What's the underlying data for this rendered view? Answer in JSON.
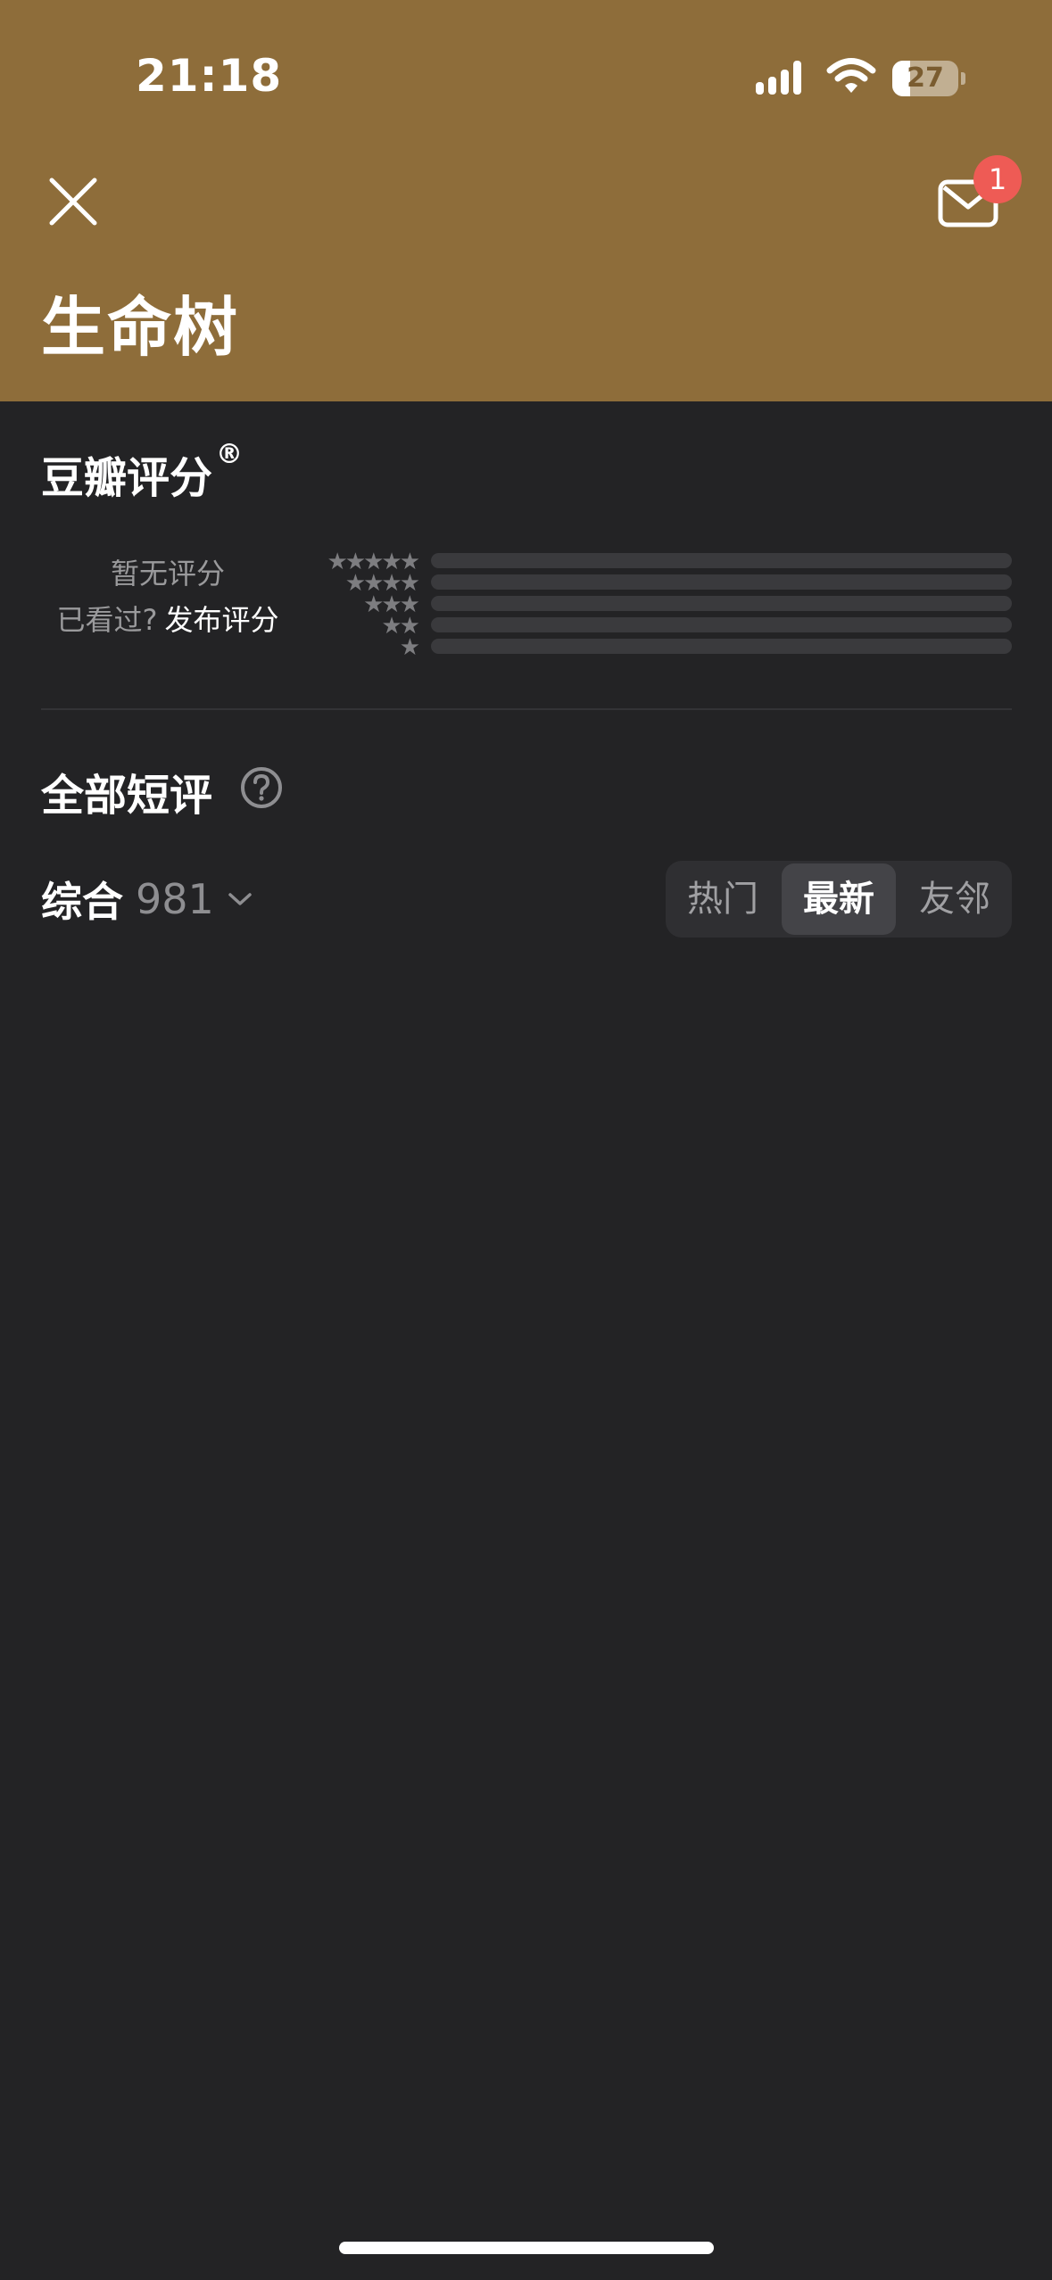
{
  "status_bar": {
    "time": "21:18",
    "battery_level": "27",
    "battery_fraction": 0.27,
    "signal_icon": "cellular-signal-icon",
    "wifi_icon": "wifi-icon"
  },
  "header": {
    "title": "生命树",
    "close_icon": "close-icon",
    "mail_icon": "envelope-icon",
    "mail_badge": "1",
    "background_color": "#8e6d3a"
  },
  "rating": {
    "title": "豆瓣评分",
    "registered_mark": "®",
    "no_rating_text": "暂无评分",
    "seen_prompt": "已看过?",
    "post_rating_link": "发布评分",
    "distribution": [
      {
        "stars": 5,
        "fraction": 0
      },
      {
        "stars": 4,
        "fraction": 0
      },
      {
        "stars": 3,
        "fraction": 0
      },
      {
        "stars": 2,
        "fraction": 0
      },
      {
        "stars": 1,
        "fraction": 0
      }
    ]
  },
  "comments": {
    "title": "全部短评",
    "help_icon": "question-circle-icon",
    "sort_label": "综合",
    "count": "981",
    "tabs": [
      {
        "label": "热门",
        "active": false
      },
      {
        "label": "最新",
        "active": true
      },
      {
        "label": "友邻",
        "active": false
      }
    ]
  },
  "colors": {
    "accent_badge": "#ee5b55",
    "page_background": "#232325"
  }
}
